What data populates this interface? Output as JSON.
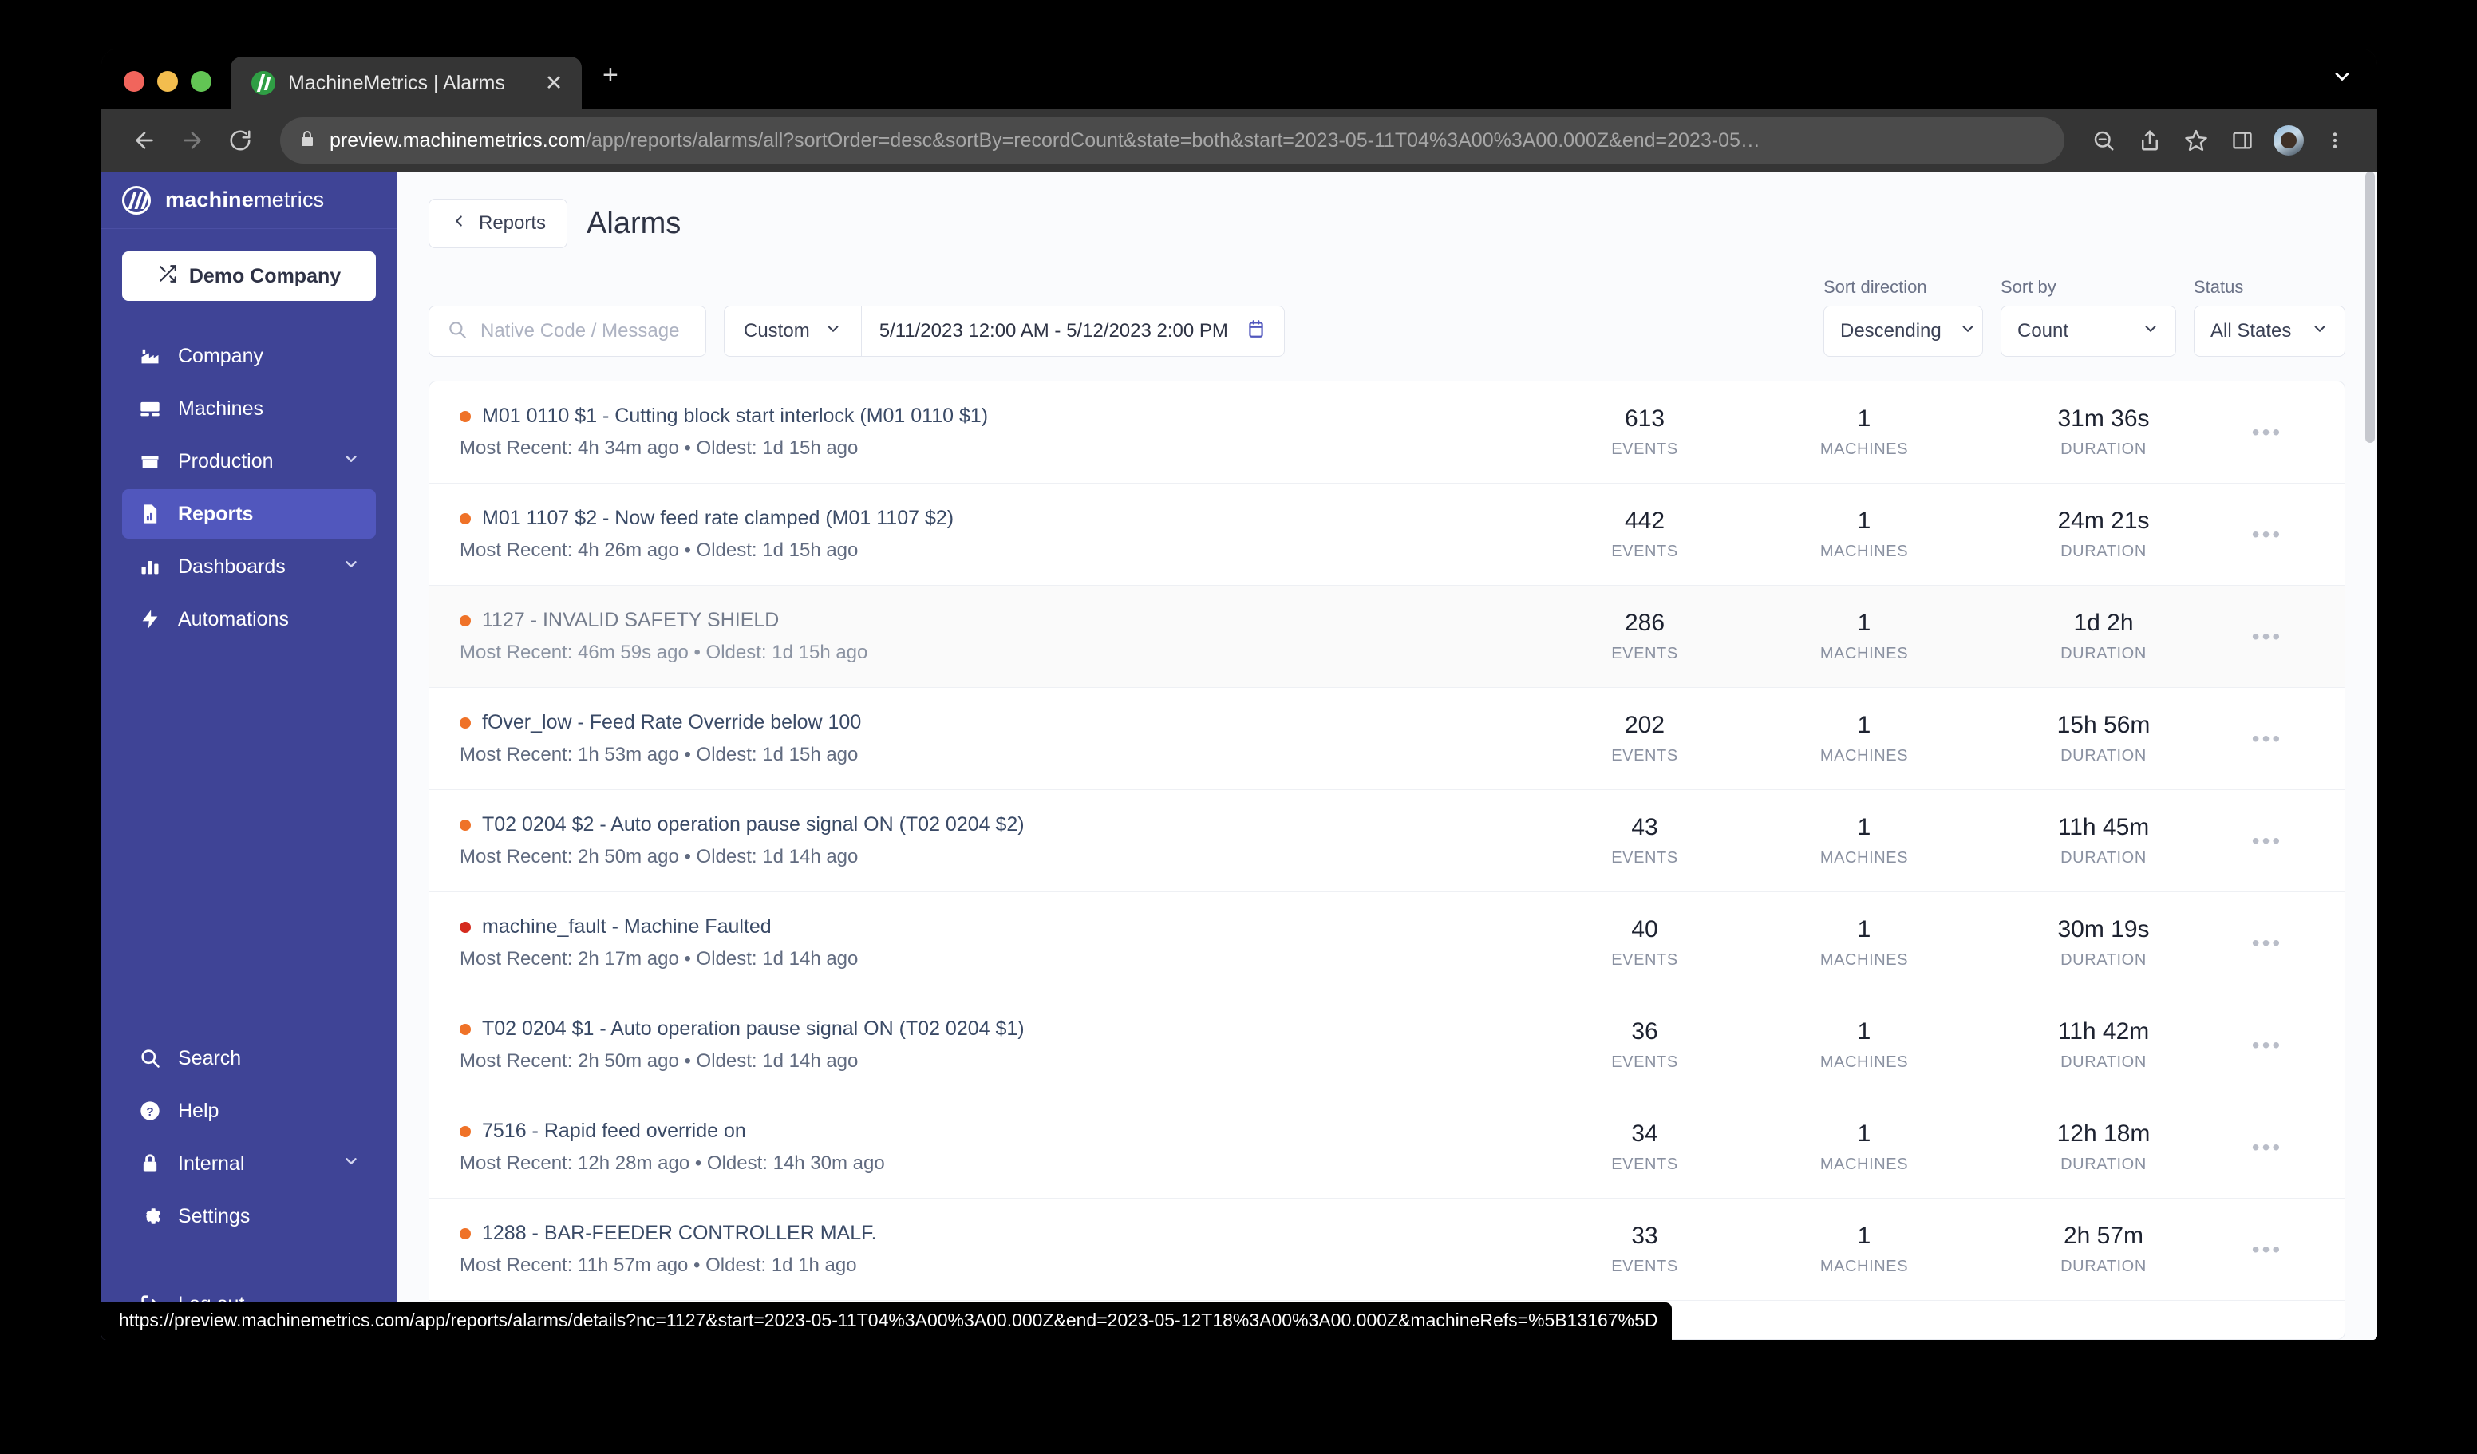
{
  "browser": {
    "tab_title": "MachineMetrics | Alarms",
    "tab_close_glyph": "✕",
    "new_tab_glyph": "+",
    "url_host": "preview.machinemetrics.com",
    "url_path": "/app/reports/alarms/all?sortOrder=desc&sortBy=recordCount&state=both&start=2023-05-11T04%3A00%3A00.000Z&end=2023-05…",
    "status_url": "https://preview.machinemetrics.com/app/reports/alarms/details?nc=1127&start=2023-05-11T04%3A00%3A00.000Z&end=2023-05-12T18%3A00%3A00.000Z&machineRefs=%5B13167%5D"
  },
  "sidebar": {
    "brand_bold": "machine",
    "brand_light": "metrics",
    "company_button": "Demo Company",
    "items": [
      {
        "label": "Company",
        "icon": "factory-icon",
        "active": false,
        "chevron": false
      },
      {
        "label": "Machines",
        "icon": "machine-icon",
        "active": false,
        "chevron": false
      },
      {
        "label": "Production",
        "icon": "box-icon",
        "active": false,
        "chevron": true
      },
      {
        "label": "Reports",
        "icon": "report-icon",
        "active": true,
        "chevron": false
      },
      {
        "label": "Dashboards",
        "icon": "bar-chart-icon",
        "active": false,
        "chevron": true
      },
      {
        "label": "Automations",
        "icon": "lightning-icon",
        "active": false,
        "chevron": false
      }
    ],
    "bottom_items": [
      {
        "label": "Search",
        "icon": "search-icon",
        "chevron": false
      },
      {
        "label": "Help",
        "icon": "help-icon",
        "chevron": false
      },
      {
        "label": "Internal",
        "icon": "lock-icon",
        "chevron": true
      },
      {
        "label": "Settings",
        "icon": "gear-icon",
        "chevron": false
      }
    ],
    "logout": {
      "label": "Log out",
      "icon": "logout-icon"
    }
  },
  "header": {
    "back_label": "Reports",
    "title": "Alarms"
  },
  "filters": {
    "search_placeholder": "Native Code / Message",
    "search_value": "",
    "range_preset": "Custom",
    "range_value": "5/11/2023 12:00 AM - 5/12/2023 2:00 PM",
    "sort_direction_label": "Sort direction",
    "sort_direction_value": "Descending",
    "sort_by_label": "Sort by",
    "sort_by_value": "Count",
    "status_label": "Status",
    "status_value": "All States"
  },
  "columns": {
    "events": "EVENTS",
    "machines": "MACHINES",
    "duration": "DURATION"
  },
  "colors": {
    "sidebar": "#3f4496",
    "sidebar_active": "#5157bd",
    "dot_orange": "#ef7228",
    "dot_red": "#d52b1e",
    "accent": "#5157bd"
  },
  "alarms": [
    {
      "title": "M01 0110 $1 - Cutting block start interlock (M01 0110 $1)",
      "subtitle": "Most Recent: 4h 34m ago • Oldest: 1d 15h ago",
      "severity": "orange",
      "events": "613",
      "machines": "1",
      "duration": "31m 36s",
      "hovered": false
    },
    {
      "title": "M01 1107 $2 - Now feed rate clamped (M01 1107 $2)",
      "subtitle": "Most Recent: 4h 26m ago • Oldest: 1d 15h ago",
      "severity": "orange",
      "events": "442",
      "machines": "1",
      "duration": "24m 21s",
      "hovered": false
    },
    {
      "title": "1127 - INVALID SAFETY SHIELD",
      "subtitle": "Most Recent: 46m 59s ago • Oldest: 1d 15h ago",
      "severity": "orange",
      "events": "286",
      "machines": "1",
      "duration": "1d 2h",
      "hovered": true
    },
    {
      "title": "fOver_low - Feed Rate Override below 100",
      "subtitle": "Most Recent: 1h 53m ago • Oldest: 1d 15h ago",
      "severity": "orange",
      "events": "202",
      "machines": "1",
      "duration": "15h 56m",
      "hovered": false
    },
    {
      "title": "T02 0204 $2 - Auto operation pause signal ON (T02 0204 $2)",
      "subtitle": "Most Recent: 2h 50m ago • Oldest: 1d 14h ago",
      "severity": "orange",
      "events": "43",
      "machines": "1",
      "duration": "11h 45m",
      "hovered": false
    },
    {
      "title": "machine_fault - Machine Faulted",
      "subtitle": "Most Recent: 2h 17m ago • Oldest: 1d 14h ago",
      "severity": "red",
      "events": "40",
      "machines": "1",
      "duration": "30m 19s",
      "hovered": false
    },
    {
      "title": "T02 0204 $1 - Auto operation pause signal ON (T02 0204 $1)",
      "subtitle": "Most Recent: 2h 50m ago • Oldest: 1d 14h ago",
      "severity": "orange",
      "events": "36",
      "machines": "1",
      "duration": "11h 42m",
      "hovered": false
    },
    {
      "title": "7516 - Rapid feed override on",
      "subtitle": "Most Recent: 12h 28m ago • Oldest: 14h 30m ago",
      "severity": "orange",
      "events": "34",
      "machines": "1",
      "duration": "12h 18m",
      "hovered": false
    },
    {
      "title": "1288 - BAR-FEEDER CONTROLLER MALF.",
      "subtitle": "Most Recent: 11h 57m ago • Oldest: 1d 1h ago",
      "severity": "orange",
      "events": "33",
      "machines": "1",
      "duration": "2h 57m",
      "hovered": false
    }
  ],
  "row_menu_glyph": "•••"
}
